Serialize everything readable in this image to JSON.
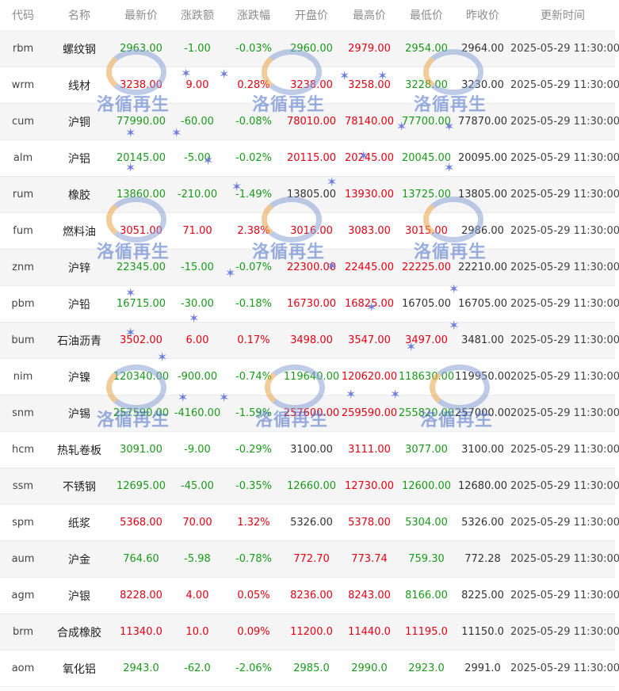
{
  "headers": [
    "代码",
    "名称",
    "最新价",
    "涨跌额",
    "涨跌幅",
    "开盘价",
    "最高价",
    "最低价",
    "昨收价",
    "更新时间"
  ],
  "watermark_text": "洛循再生",
  "rows": [
    {
      "code": "rbm",
      "name": "螺纹钢",
      "latest": "2963.00",
      "chg": "-1.00",
      "pct": "-0.03%",
      "open": "2960.00",
      "high": "2979.00",
      "low": "2954.00",
      "prev": "2964.00",
      "time": "2025-05-29 11:30:00",
      "dir": "down",
      "oc": "down",
      "hc": "up",
      "lc": "down"
    },
    {
      "code": "wrm",
      "name": "线材",
      "latest": "3238.00",
      "chg": "9.00",
      "pct": "0.28%",
      "open": "3238.00",
      "high": "3258.00",
      "low": "3228.00",
      "prev": "3230.00",
      "time": "2025-05-29 11:30:00",
      "dir": "up",
      "oc": "up",
      "hc": "up",
      "lc": "down"
    },
    {
      "code": "cum",
      "name": "沪铜",
      "latest": "77990.00",
      "chg": "-60.00",
      "pct": "-0.08%",
      "open": "78010.00",
      "high": "78140.00",
      "low": "77700.00",
      "prev": "77870.00",
      "time": "2025-05-29 11:30:00",
      "dir": "down",
      "oc": "up",
      "hc": "up",
      "lc": "down"
    },
    {
      "code": "alm",
      "name": "沪铝",
      "latest": "20145.00",
      "chg": "-5.00",
      "pct": "-0.02%",
      "open": "20115.00",
      "high": "20245.00",
      "low": "20045.00",
      "prev": "20095.00",
      "time": "2025-05-29 11:30:00",
      "dir": "down",
      "oc": "up",
      "hc": "up",
      "lc": "down"
    },
    {
      "code": "rum",
      "name": "橡胶",
      "latest": "13860.00",
      "chg": "-210.00",
      "pct": "-1.49%",
      "open": "13805.00",
      "high": "13930.00",
      "low": "13725.00",
      "prev": "13805.00",
      "time": "2025-05-29 11:30:00",
      "dir": "down",
      "oc": "flat",
      "hc": "up",
      "lc": "down"
    },
    {
      "code": "fum",
      "name": "燃料油",
      "latest": "3051.00",
      "chg": "71.00",
      "pct": "2.38%",
      "open": "3016.00",
      "high": "3083.00",
      "low": "3015.00",
      "prev": "2986.00",
      "time": "2025-05-29 11:30:00",
      "dir": "up",
      "oc": "up",
      "hc": "up",
      "lc": "up"
    },
    {
      "code": "znm",
      "name": "沪锌",
      "latest": "22345.00",
      "chg": "-15.00",
      "pct": "-0.07%",
      "open": "22300.00",
      "high": "22445.00",
      "low": "22225.00",
      "prev": "22210.00",
      "time": "2025-05-29 11:30:00",
      "dir": "down",
      "oc": "up",
      "hc": "up",
      "lc": "up"
    },
    {
      "code": "pbm",
      "name": "沪铅",
      "latest": "16715.00",
      "chg": "-30.00",
      "pct": "-0.18%",
      "open": "16730.00",
      "high": "16825.00",
      "low": "16705.00",
      "prev": "16705.00",
      "time": "2025-05-29 11:30:00",
      "dir": "down",
      "oc": "up",
      "hc": "up",
      "lc": "flat"
    },
    {
      "code": "bum",
      "name": "石油沥青",
      "latest": "3502.00",
      "chg": "6.00",
      "pct": "0.17%",
      "open": "3498.00",
      "high": "3547.00",
      "low": "3497.00",
      "prev": "3481.00",
      "time": "2025-05-29 11:30:00",
      "dir": "up",
      "oc": "up",
      "hc": "up",
      "lc": "up"
    },
    {
      "code": "nim",
      "name": "沪镍",
      "latest": "120340.00",
      "chg": "-900.00",
      "pct": "-0.74%",
      "open": "119640.00",
      "high": "120620.00",
      "low": "118630.00",
      "prev": "119950.00",
      "time": "2025-05-29 11:30:00",
      "dir": "down",
      "oc": "down",
      "hc": "up",
      "lc": "down"
    },
    {
      "code": "snm",
      "name": "沪锡",
      "latest": "257590.00",
      "chg": "-4160.00",
      "pct": "-1.59%",
      "open": "257600.00",
      "high": "259590.00",
      "low": "255820.00",
      "prev": "257000.00",
      "time": "2025-05-29 11:30:00",
      "dir": "down",
      "oc": "up",
      "hc": "up",
      "lc": "down"
    },
    {
      "code": "hcm",
      "name": "热轧卷板",
      "latest": "3091.00",
      "chg": "-9.00",
      "pct": "-0.29%",
      "open": "3100.00",
      "high": "3111.00",
      "low": "3077.00",
      "prev": "3100.00",
      "time": "2025-05-29 11:30:00",
      "dir": "down",
      "oc": "flat",
      "hc": "up",
      "lc": "down"
    },
    {
      "code": "ssm",
      "name": "不锈钢",
      "latest": "12695.00",
      "chg": "-45.00",
      "pct": "-0.35%",
      "open": "12660.00",
      "high": "12730.00",
      "low": "12600.00",
      "prev": "12680.00",
      "time": "2025-05-29 11:30:00",
      "dir": "down",
      "oc": "down",
      "hc": "up",
      "lc": "down"
    },
    {
      "code": "spm",
      "name": "纸浆",
      "latest": "5368.00",
      "chg": "70.00",
      "pct": "1.32%",
      "open": "5326.00",
      "high": "5378.00",
      "low": "5304.00",
      "prev": "5326.00",
      "time": "2025-05-29 11:30:00",
      "dir": "up",
      "oc": "flat",
      "hc": "up",
      "lc": "down"
    },
    {
      "code": "aum",
      "name": "沪金",
      "latest": "764.60",
      "chg": "-5.98",
      "pct": "-0.78%",
      "open": "772.70",
      "high": "773.74",
      "low": "759.30",
      "prev": "772.28",
      "time": "2025-05-29 11:30:00",
      "dir": "down",
      "oc": "up",
      "hc": "up",
      "lc": "down"
    },
    {
      "code": "agm",
      "name": "沪银",
      "latest": "8228.00",
      "chg": "4.00",
      "pct": "0.05%",
      "open": "8236.00",
      "high": "8243.00",
      "low": "8166.00",
      "prev": "8225.00",
      "time": "2025-05-29 11:30:00",
      "dir": "up",
      "oc": "up",
      "hc": "up",
      "lc": "down"
    },
    {
      "code": "brm",
      "name": "合成橡胶",
      "latest": "11340.0",
      "chg": "10.0",
      "pct": "0.09%",
      "open": "11200.0",
      "high": "11440.0",
      "low": "11195.0",
      "prev": "11150.0",
      "time": "2025-05-29 11:30:00",
      "dir": "up",
      "oc": "up",
      "hc": "up",
      "lc": "up"
    },
    {
      "code": "aom",
      "name": "氧化铝",
      "latest": "2943.0",
      "chg": "-62.0",
      "pct": "-2.06%",
      "open": "2985.0",
      "high": "2990.0",
      "low": "2923.0",
      "prev": "2991.0",
      "time": "2025-05-29 11:30:00",
      "dir": "down",
      "oc": "down",
      "hc": "down",
      "lc": "down"
    }
  ],
  "colors": {
    "up": "#e60012",
    "down": "#1a9a1a",
    "header": "#8c8c8c",
    "watermark": "#4a6fc7",
    "star": "#6f7fe0"
  }
}
